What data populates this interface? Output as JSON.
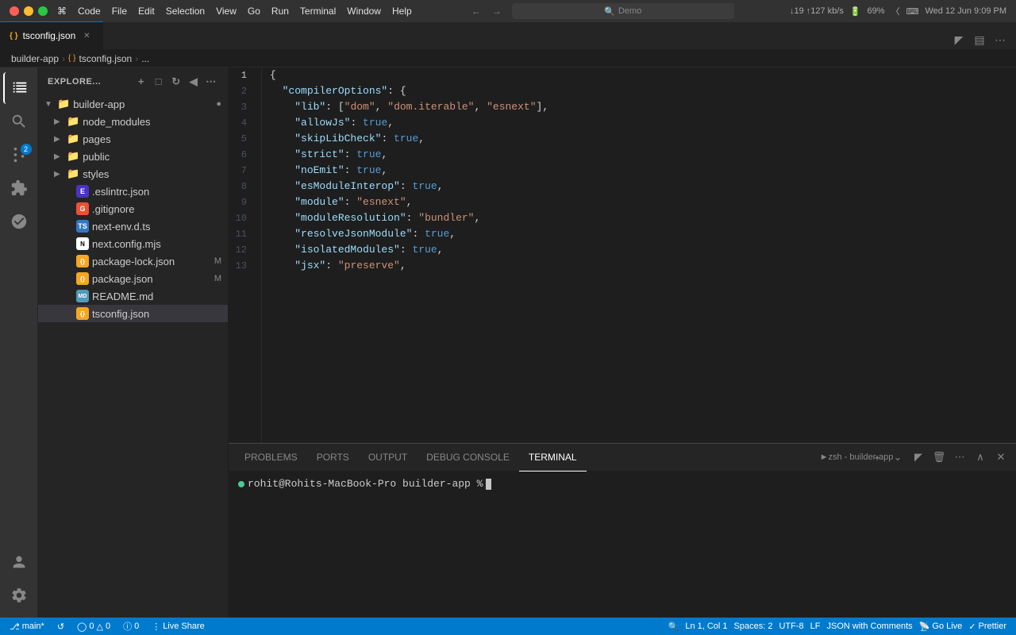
{
  "titlebar": {
    "app_name": "Code",
    "menu_items": [
      "File",
      "Edit",
      "Selection",
      "View",
      "Go",
      "Run",
      "Terminal",
      "Window",
      "Help"
    ],
    "search_placeholder": "Demo",
    "time": "Wed 12 Jun  9:09 PM",
    "battery": "69%",
    "network_speed": "↓19 ↑127 kb/s"
  },
  "tab": {
    "filename": "tsconfig.json",
    "icon": "{ }",
    "is_active": true
  },
  "breadcrumb": {
    "root": "builder-app",
    "file": "tsconfig.json",
    "extra": "..."
  },
  "sidebar": {
    "title": "EXPLORE...",
    "root_folder": "builder-app",
    "items": [
      {
        "type": "folder",
        "name": "node_modules",
        "indent": 1,
        "expanded": false,
        "icon": "node"
      },
      {
        "type": "folder",
        "name": "pages",
        "indent": 1,
        "expanded": false,
        "icon": "pages"
      },
      {
        "type": "folder",
        "name": "public",
        "indent": 1,
        "expanded": false,
        "icon": "public"
      },
      {
        "type": "folder",
        "name": "styles",
        "indent": 1,
        "expanded": false,
        "icon": "styles"
      },
      {
        "type": "file",
        "name": ".eslintrc.json",
        "indent": 1,
        "icon": "eslint"
      },
      {
        "type": "file",
        "name": ".gitignore",
        "indent": 1,
        "icon": "git"
      },
      {
        "type": "file",
        "name": "next-env.d.ts",
        "indent": 1,
        "icon": "ts"
      },
      {
        "type": "file",
        "name": "next.config.mjs",
        "indent": 1,
        "icon": "next"
      },
      {
        "type": "file",
        "name": "package-lock.json",
        "indent": 1,
        "icon": "json",
        "badge": "M"
      },
      {
        "type": "file",
        "name": "package.json",
        "indent": 1,
        "icon": "json",
        "badge": "M"
      },
      {
        "type": "file",
        "name": "README.md",
        "indent": 1,
        "icon": "md"
      },
      {
        "type": "file",
        "name": "tsconfig.json",
        "indent": 1,
        "icon": "json",
        "selected": true
      }
    ]
  },
  "editor": {
    "lines": [
      {
        "num": 1,
        "tokens": [
          {
            "cls": "t-brace",
            "text": "{"
          }
        ]
      },
      {
        "num": 2,
        "tokens": [
          {
            "cls": "t-punct",
            "text": "  "
          },
          {
            "cls": "t-key",
            "text": "\"compilerOptions\""
          },
          {
            "cls": "t-colon",
            "text": ": {"
          }
        ]
      },
      {
        "num": 3,
        "tokens": [
          {
            "cls": "t-punct",
            "text": "    "
          },
          {
            "cls": "t-key",
            "text": "\"lib\""
          },
          {
            "cls": "t-colon",
            "text": ": ["
          },
          {
            "cls": "t-string",
            "text": "\"dom\""
          },
          {
            "cls": "t-punct",
            "text": ", "
          },
          {
            "cls": "t-string",
            "text": "\"dom.iterable\""
          },
          {
            "cls": "t-punct",
            "text": ", "
          },
          {
            "cls": "t-string",
            "text": "\"esnext\""
          },
          {
            "cls": "t-punct",
            "text": "],"
          }
        ]
      },
      {
        "num": 4,
        "tokens": [
          {
            "cls": "t-punct",
            "text": "    "
          },
          {
            "cls": "t-key",
            "text": "\"allowJs\""
          },
          {
            "cls": "t-colon",
            "text": ": "
          },
          {
            "cls": "t-bool",
            "text": "true"
          },
          {
            "cls": "t-punct",
            "text": ","
          }
        ]
      },
      {
        "num": 5,
        "tokens": [
          {
            "cls": "t-punct",
            "text": "    "
          },
          {
            "cls": "t-key",
            "text": "\"skipLibCheck\""
          },
          {
            "cls": "t-colon",
            "text": ": "
          },
          {
            "cls": "t-bool",
            "text": "true"
          },
          {
            "cls": "t-punct",
            "text": ","
          }
        ]
      },
      {
        "num": 6,
        "tokens": [
          {
            "cls": "t-punct",
            "text": "    "
          },
          {
            "cls": "t-key",
            "text": "\"strict\""
          },
          {
            "cls": "t-colon",
            "text": ": "
          },
          {
            "cls": "t-bool",
            "text": "true"
          },
          {
            "cls": "t-punct",
            "text": ","
          }
        ]
      },
      {
        "num": 7,
        "tokens": [
          {
            "cls": "t-punct",
            "text": "    "
          },
          {
            "cls": "t-key",
            "text": "\"noEmit\""
          },
          {
            "cls": "t-colon",
            "text": ": "
          },
          {
            "cls": "t-bool",
            "text": "true"
          },
          {
            "cls": "t-punct",
            "text": ","
          }
        ]
      },
      {
        "num": 8,
        "tokens": [
          {
            "cls": "t-punct",
            "text": "    "
          },
          {
            "cls": "t-key",
            "text": "\"esModuleInterop\""
          },
          {
            "cls": "t-colon",
            "text": ": "
          },
          {
            "cls": "t-bool",
            "text": "true"
          },
          {
            "cls": "t-punct",
            "text": ","
          }
        ]
      },
      {
        "num": 9,
        "tokens": [
          {
            "cls": "t-punct",
            "text": "    "
          },
          {
            "cls": "t-key",
            "text": "\"module\""
          },
          {
            "cls": "t-colon",
            "text": ": "
          },
          {
            "cls": "t-string",
            "text": "\"esnext\""
          },
          {
            "cls": "t-punct",
            "text": ","
          }
        ]
      },
      {
        "num": 10,
        "tokens": [
          {
            "cls": "t-punct",
            "text": "    "
          },
          {
            "cls": "t-key",
            "text": "\"moduleResolution\""
          },
          {
            "cls": "t-colon",
            "text": ": "
          },
          {
            "cls": "t-string",
            "text": "\"bundler\""
          },
          {
            "cls": "t-punct",
            "text": ","
          }
        ]
      },
      {
        "num": 11,
        "tokens": [
          {
            "cls": "t-punct",
            "text": "    "
          },
          {
            "cls": "t-key",
            "text": "\"resolveJsonModule\""
          },
          {
            "cls": "t-colon",
            "text": ": "
          },
          {
            "cls": "t-bool",
            "text": "true"
          },
          {
            "cls": "t-punct",
            "text": ","
          }
        ]
      },
      {
        "num": 12,
        "tokens": [
          {
            "cls": "t-punct",
            "text": "    "
          },
          {
            "cls": "t-key",
            "text": "\"isolatedModules\""
          },
          {
            "cls": "t-colon",
            "text": ": "
          },
          {
            "cls": "t-bool",
            "text": "true"
          },
          {
            "cls": "t-punct",
            "text": ","
          }
        ]
      },
      {
        "num": 13,
        "tokens": [
          {
            "cls": "t-punct",
            "text": "    "
          },
          {
            "cls": "t-key",
            "text": "\"jsx\""
          },
          {
            "cls": "t-colon",
            "text": ": "
          },
          {
            "cls": "t-string",
            "text": "\"preserve\""
          },
          {
            "cls": "t-punct",
            "text": ","
          }
        ]
      }
    ]
  },
  "terminal": {
    "tabs": [
      "PROBLEMS",
      "PORTS",
      "OUTPUT",
      "DEBUG CONSOLE",
      "TERMINAL"
    ],
    "active_tab": "TERMINAL",
    "shell_name": "zsh - builder-app",
    "prompt": "rohit@Rohits-MacBook-Pro builder-app % "
  },
  "statusbar": {
    "branch": "main*",
    "sync_icon": "↺",
    "errors": "0",
    "warnings": "0",
    "info": "0",
    "live_share": "Live Share",
    "ln": "Ln 1, Col 1",
    "spaces": "Spaces: 2",
    "encoding": "UTF-8",
    "eol": "LF",
    "language": "JSON with Comments",
    "go_live": "Go Live",
    "prettier": "Prettier"
  }
}
